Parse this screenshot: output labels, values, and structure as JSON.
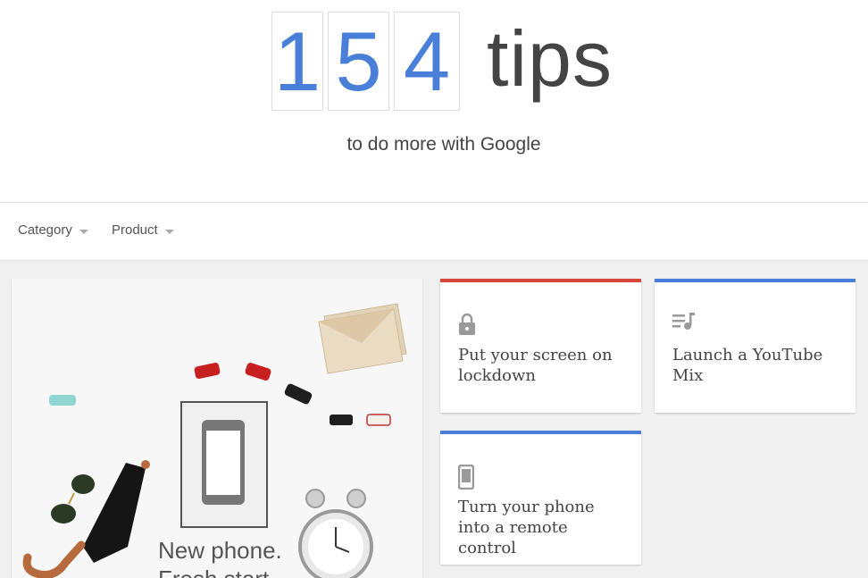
{
  "hero": {
    "digits": [
      "1",
      "5",
      "4"
    ],
    "word": "tips",
    "subtitle": "to do more with Google",
    "accent_color": "#4a7fd9"
  },
  "filters": [
    {
      "label": "Category",
      "icon": "chevron-down-icon"
    },
    {
      "label": "Product",
      "icon": "chevron-down-icon"
    }
  ],
  "feature": {
    "line1": "New phone.",
    "line2": "Fresh start"
  },
  "tips": [
    {
      "title": "Put your screen on lockdown",
      "icon": "lock-icon",
      "bar_color": "#d9473b"
    },
    {
      "title": "Launch a YouTube Mix",
      "icon": "playlist-icon",
      "bar_color": "#4a7fd9"
    },
    {
      "title": "Turn your phone into a remote control",
      "icon": "phone-icon",
      "bar_color": "#4a7fd9"
    }
  ]
}
